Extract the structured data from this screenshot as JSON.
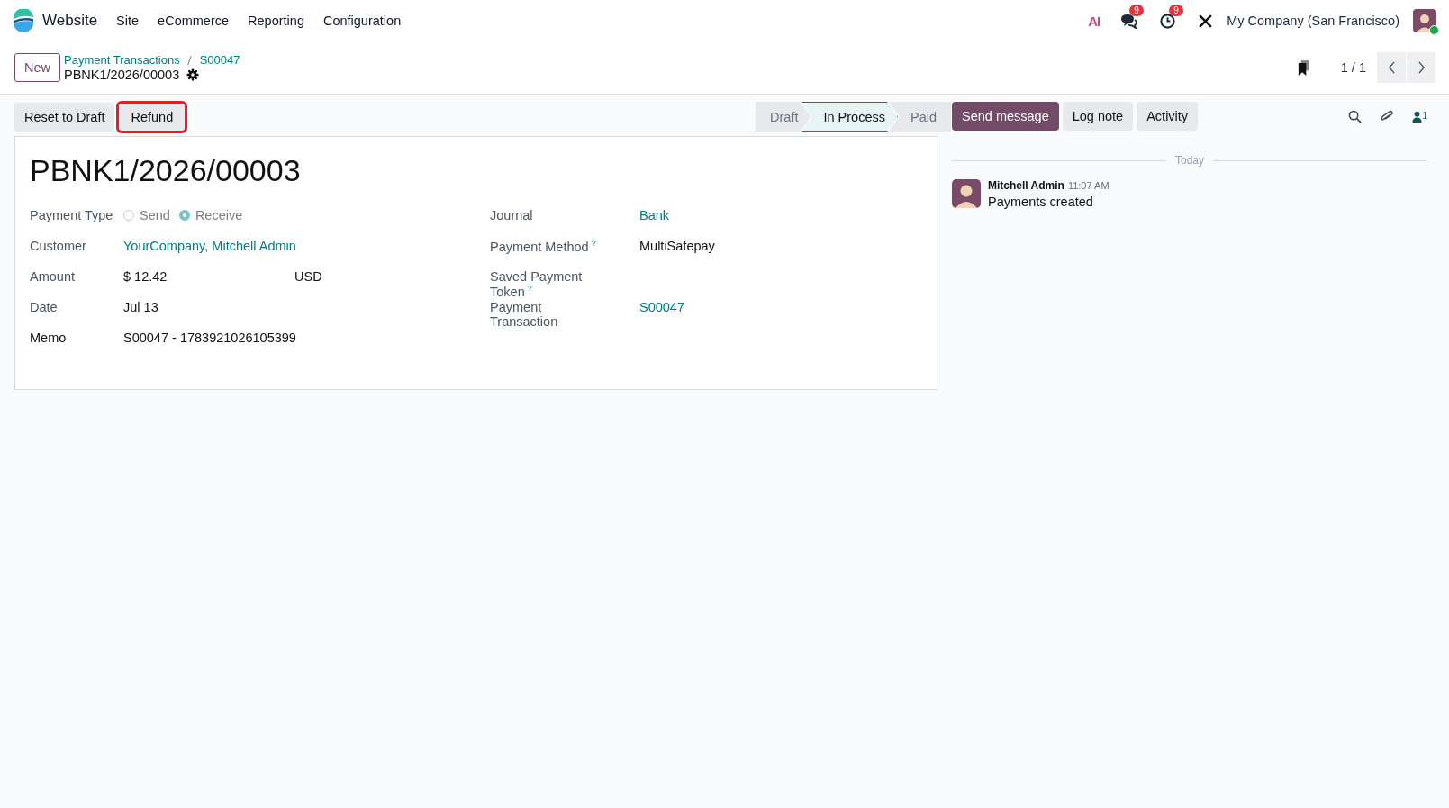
{
  "navbar": {
    "app_name": "Website",
    "menus": [
      "Site",
      "eCommerce",
      "Reporting",
      "Configuration"
    ],
    "systray": {
      "ai_label": "AI",
      "messages_badge": "9",
      "activities_badge": "9",
      "company": "My Company (San Francisco)",
      "user_online": true
    }
  },
  "control_panel": {
    "new_button": "New",
    "breadcrumbs": [
      "Payment Transactions",
      "S00047"
    ],
    "record_name": "PBNK1/2026/00003",
    "pager": "1 / 1"
  },
  "actions": [
    {
      "label": "Reset to Draft",
      "highlighted": false
    },
    {
      "label": "Refund",
      "highlighted": true
    }
  ],
  "statusbar": [
    {
      "label": "Draft",
      "selected": false
    },
    {
      "label": "In Process",
      "selected": true
    },
    {
      "label": "Paid",
      "selected": false
    }
  ],
  "form": {
    "title": "PBNK1/2026/00003",
    "payment_type": {
      "label": "Payment Type",
      "options": [
        {
          "label": "Send",
          "selected": false
        },
        {
          "label": "Receive",
          "selected": true
        }
      ]
    },
    "left_fields": [
      {
        "label": "Customer",
        "value": "YourCompany, Mitchell Admin",
        "kind": "link",
        "required": false
      },
      {
        "label": "Amount",
        "value": "$ 12.42",
        "extra": "USD",
        "kind": "text",
        "required": false
      },
      {
        "label": "Date",
        "value": "Jul 13",
        "kind": "text",
        "required": false
      },
      {
        "label": "Memo",
        "value": "S00047 - 1783921026105399",
        "kind": "text",
        "required": true
      }
    ],
    "right_fields": [
      {
        "label": "Journal",
        "value": "Bank",
        "kind": "link",
        "help": false
      },
      {
        "label": "Payment Method",
        "help_mark": "?",
        "value": "MultiSafepay",
        "kind": "text",
        "help": true
      },
      {
        "label": "Saved Payment Token",
        "help_mark": "?",
        "kind": "empty",
        "help": true
      },
      {
        "label": "Payment Transaction",
        "value": "S00047",
        "kind": "link",
        "help": false
      }
    ]
  },
  "chatter": {
    "buttons": [
      {
        "label": "Send message",
        "primary": true
      },
      {
        "label": "Log note",
        "primary": false
      },
      {
        "label": "Activity",
        "primary": false
      }
    ],
    "followers_count": "1",
    "divider": "Today",
    "messages": [
      {
        "author": "Mitchell Admin",
        "time": "11:07 AM",
        "body": "Payments created"
      }
    ]
  }
}
